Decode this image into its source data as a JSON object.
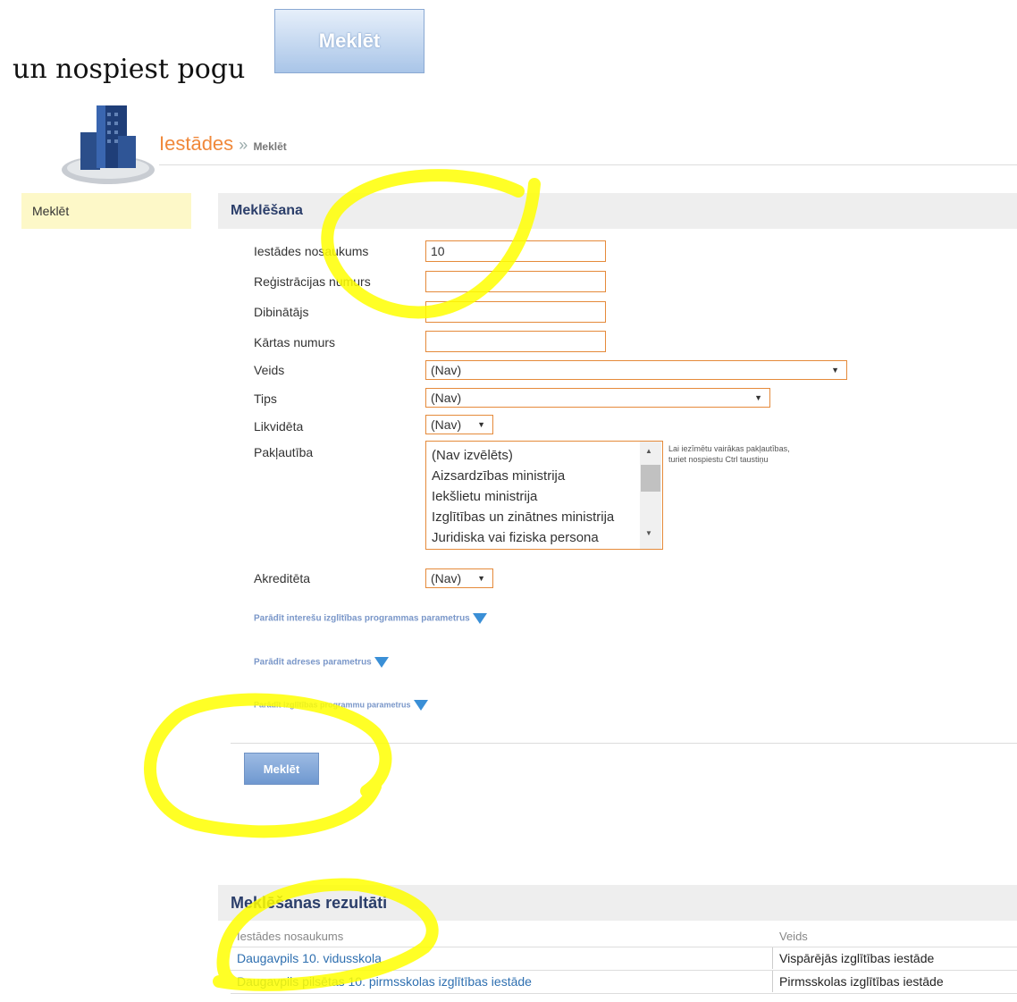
{
  "intro": {
    "text": "un nospiest pogu",
    "button_label": "Meklēt"
  },
  "header": {
    "section": "Iestādes",
    "separator": "»",
    "current": "Meklēt"
  },
  "sidebar": {
    "items": [
      {
        "label": "Meklēt"
      }
    ]
  },
  "search_section": {
    "title": "Meklēšana",
    "fields": {
      "name": {
        "label": "Iestādes nosaukums",
        "value": "10"
      },
      "reg_number": {
        "label": "Reģistrācijas numurs",
        "value": ""
      },
      "founder": {
        "label": "Dibinātājs",
        "value": ""
      },
      "order_number": {
        "label": "Kārtas numurs",
        "value": ""
      },
      "kind": {
        "label": "Veids",
        "value": "(Nav)"
      },
      "type": {
        "label": "Tips",
        "value": "(Nav)"
      },
      "liquidated": {
        "label": "Likvidēta",
        "value": "(Nav)"
      },
      "subordination": {
        "label": "Pakļautība",
        "options": [
          "(Nav izvēlēts)",
          "Aizsardzības ministrija",
          "Iekšlietu ministrija",
          "Izglītības un zinātnes ministrija",
          "Juridiska vai fiziska persona"
        ],
        "hint_line1": "Lai iezīmētu vairākas pakļautības,",
        "hint_line2": "turiet nospiestu Ctrl taustiņu"
      },
      "accredited": {
        "label": "Akreditēta",
        "value": "(Nav)"
      }
    },
    "toggles": [
      "Parādīt interešu izglītības programmas parametrus",
      "Parādīt adreses parametrus",
      "Parādīt izglītības programmu parametrus"
    ],
    "submit_label": "Meklēt"
  },
  "results": {
    "title": "Meklēšanas rezultāti",
    "columns": [
      "Iestādes nosaukums",
      "Veids"
    ],
    "rows": [
      {
        "name": "Daugavpils 10. vidusskola",
        "kind": "Vispārējās izglītības iestāde"
      },
      {
        "name": "Daugavpils pilsētas 10. pirmsskolas izglītības iestāde",
        "kind": "Pirmsskolas izglītības iestāde"
      }
    ]
  },
  "colors": {
    "accent_orange": "#f0883a",
    "link_blue": "#2e6fb0",
    "highlight_yellow": "#ffff00",
    "sidebar_bg": "#fdf8c8"
  },
  "icons": [
    "building-logo-icon",
    "dropdown-arrow-icon",
    "expand-triangle-icon"
  ]
}
